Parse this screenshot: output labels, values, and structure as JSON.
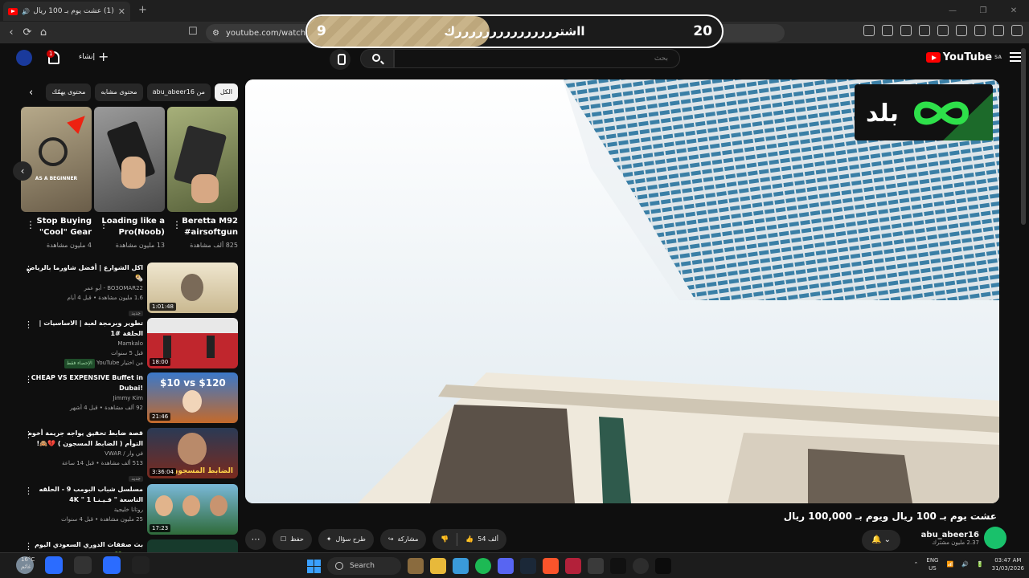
{
  "browser": {
    "tab_title": "(1) عشت يوم بـ 100 ريال ويوم",
    "url": "youtube.com/watch?v="
  },
  "banner": {
    "left_number": "9",
    "message": "ااشترررررررررررررررك",
    "right_number": "20",
    "progress": 0.44
  },
  "youtube": {
    "logo_text": "YouTube",
    "region": "SA",
    "search_placeholder": "بحث",
    "create_label": "إنشاء",
    "notifications_count": "1"
  },
  "chips": [
    "الكل",
    "من abu_abeer16",
    "محتوى مشابه",
    "محتوى يهمّك"
  ],
  "shorts": [
    {
      "title": "Beretta M92 #airsoftgun",
      "views": "825 ألف مشاهدة",
      "color": "#8a8f5a"
    },
    {
      "title": "Loading like a Pro(Noob)",
      "views": "13 مليون مشاهدة",
      "color": "#6b6b6b"
    },
    {
      "title": "Stop Buying \"Cool\" Gear",
      "views": "4 مليون مشاهدة",
      "color": "#7a6b55"
    }
  ],
  "videos": [
    {
      "title": "اكل الشوارع | أفضل شاورما بالرياض 🌯",
      "channel": "BO3OMAR22 - أبو عمر",
      "meta": "1.6 مليون مشاهدة • قبل 4 أيام",
      "badge": "جديد",
      "duration": "1:01:48",
      "color": "#d8c9a3"
    },
    {
      "title": "تطوير وبرمجة لعبة | الاساسيات | الحلقة #1",
      "channel": "Mamkalo",
      "meta": "قبل 5 سنوات",
      "badge": "الإحصاء فقط",
      "extra": "من اختيار YouTube",
      "duration": "18:00",
      "color": "#c0262d"
    },
    {
      "title": "CHEAP VS EXPENSIVE Buffet in Dubai!",
      "channel": "Jimmy Kim",
      "meta": "92 ألف مشاهدة • قبل 4 أشهر",
      "duration": "21:46",
      "color": "#3a78c9"
    },
    {
      "title": "قصة ضابط تحقيق يواجه جريمة أخوه التوأم ( الضابط المسجون ) 💔🙈!",
      "channel": "في وار / VWAR",
      "meta": "513 ألف مشاهدة • قبل 14 ساعة",
      "badge": "جديد",
      "duration": "3:36:04",
      "color": "#7a2a1e"
    },
    {
      "title": "مسلسل شباب البومب 9 - الحلقه التاسعة \" فـيـنـا 1 \" 4K",
      "channel": "روتانا خليجية",
      "meta": "25 مليون مشاهدة • قبل 4 سنوات",
      "duration": "17:23",
      "color": "#2f6b3a"
    },
    {
      "title": "بث صفقات الدوري السعودي اليوم التالي 💚",
      "channel": "",
      "meta": "",
      "duration": "",
      "color": "#173a2c"
    }
  ],
  "video": {
    "title": "عشت يوم بـ 100 ريال ويوم بـ 100,000 ريال",
    "channel_name": "abu_abeer16",
    "subscribers": "2.37 مليون مشترك",
    "likes": "54 ألف",
    "share_label": "مشاركة",
    "ask_label": "طرح سؤال",
    "save_label": "حفظ"
  },
  "taskbar": {
    "search_label": "Search",
    "lang_top": "ENG",
    "lang_bottom": "US",
    "time": "03:47 AM",
    "date": "31/03/2026",
    "weather": "16°C",
    "weather_desc": "غائم"
  }
}
